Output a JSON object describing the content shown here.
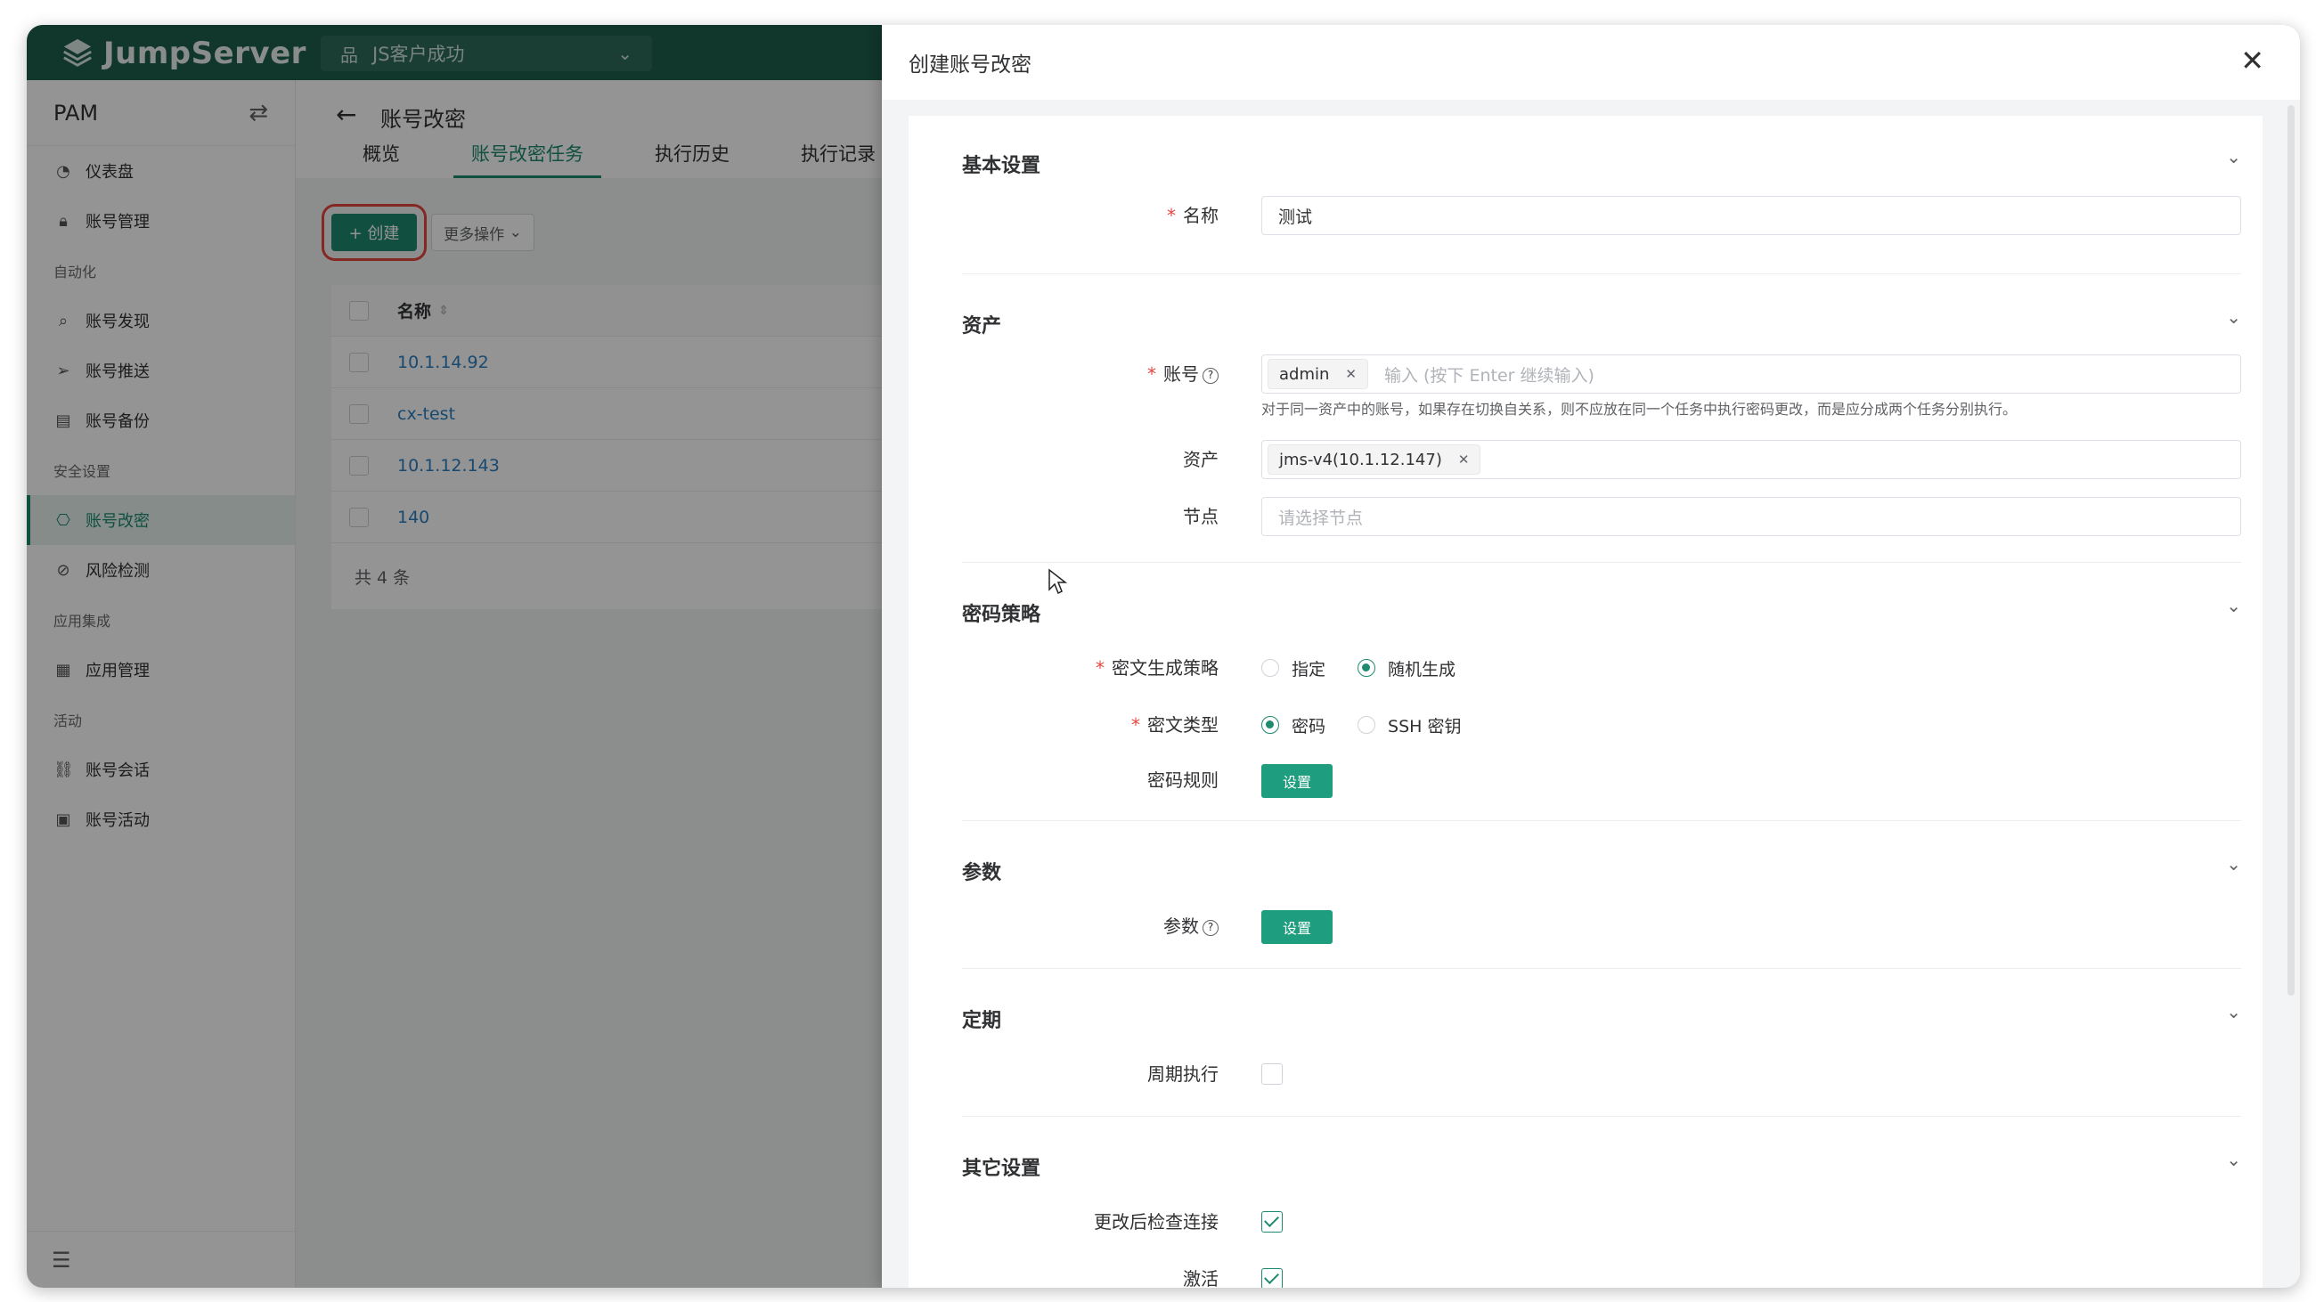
{
  "app": {
    "logo_text": "JumpServer",
    "org_name": "JS客户成功"
  },
  "sidebar": {
    "title": "PAM",
    "items": [
      {
        "type": "item",
        "icon": "dashboard-icon",
        "label": "仪表盘"
      },
      {
        "type": "item",
        "icon": "lock-icon",
        "label": "账号管理"
      },
      {
        "type": "group",
        "label": "自动化"
      },
      {
        "type": "item",
        "icon": "search-icon",
        "label": "账号发现"
      },
      {
        "type": "item",
        "icon": "send-icon",
        "label": "账号推送"
      },
      {
        "type": "item",
        "icon": "backup-icon",
        "label": "账号备份"
      },
      {
        "type": "group",
        "label": "安全设置"
      },
      {
        "type": "item",
        "icon": "key-lock-icon",
        "label": "账号改密",
        "active": true
      },
      {
        "type": "item",
        "icon": "risk-icon",
        "label": "风险检测"
      },
      {
        "type": "group",
        "label": "应用集成"
      },
      {
        "type": "item",
        "icon": "apps-icon",
        "label": "应用管理"
      },
      {
        "type": "group",
        "label": "活动"
      },
      {
        "type": "item",
        "icon": "link-icon",
        "label": "账号会话"
      },
      {
        "type": "item",
        "icon": "calendar-icon",
        "label": "账号活动"
      }
    ]
  },
  "main": {
    "title": "账号改密",
    "tabs": [
      "概览",
      "账号改密任务",
      "执行历史",
      "执行记录"
    ],
    "active_tab": 1,
    "create_label": "+ 创建",
    "more_label": "更多操作",
    "table": {
      "header": "名称",
      "rows": [
        "10.1.14.92",
        "cx-test",
        "10.1.12.143",
        "140"
      ],
      "total": "共 4 条"
    }
  },
  "drawer": {
    "title": "创建账号改密",
    "sections": {
      "basic": {
        "title": "基本设置",
        "name_label": "名称",
        "name_value": "测试"
      },
      "assets": {
        "title": "资产",
        "account_label": "账号",
        "account_tag": "admin",
        "account_placeholder": "输入 (按下 Enter 继续输入)",
        "account_hint": "对于同一资产中的账号，如果存在切换自关系，则不应放在同一个任务中执行密码更改，而是应分成两个任务分别执行。",
        "asset_label": "资产",
        "asset_tag": "jms-v4(10.1.12.147)",
        "node_label": "节点",
        "node_placeholder": "请选择节点"
      },
      "password": {
        "title": "密码策略",
        "strategy_label": "密文生成策略",
        "strategy_options": [
          "指定",
          "随机生成"
        ],
        "strategy_selected": "随机生成",
        "type_label": "密文类型",
        "type_options": [
          "密码",
          "SSH 密钥"
        ],
        "type_selected": "密码",
        "rule_label": "密码规则",
        "rule_button": "设置"
      },
      "params": {
        "title": "参数",
        "label": "参数",
        "button": "设置"
      },
      "schedule": {
        "title": "定期",
        "periodic_label": "周期执行",
        "periodic_checked": false
      },
      "other": {
        "title": "其它设置",
        "check_label": "更改后检查连接",
        "check_checked": true,
        "active_label": "激活",
        "active_checked": true
      }
    }
  },
  "colors": {
    "brand": "#1e8a6f",
    "topbar": "#1e5e4d",
    "danger": "#e6463f",
    "link": "#2a7fc1"
  }
}
